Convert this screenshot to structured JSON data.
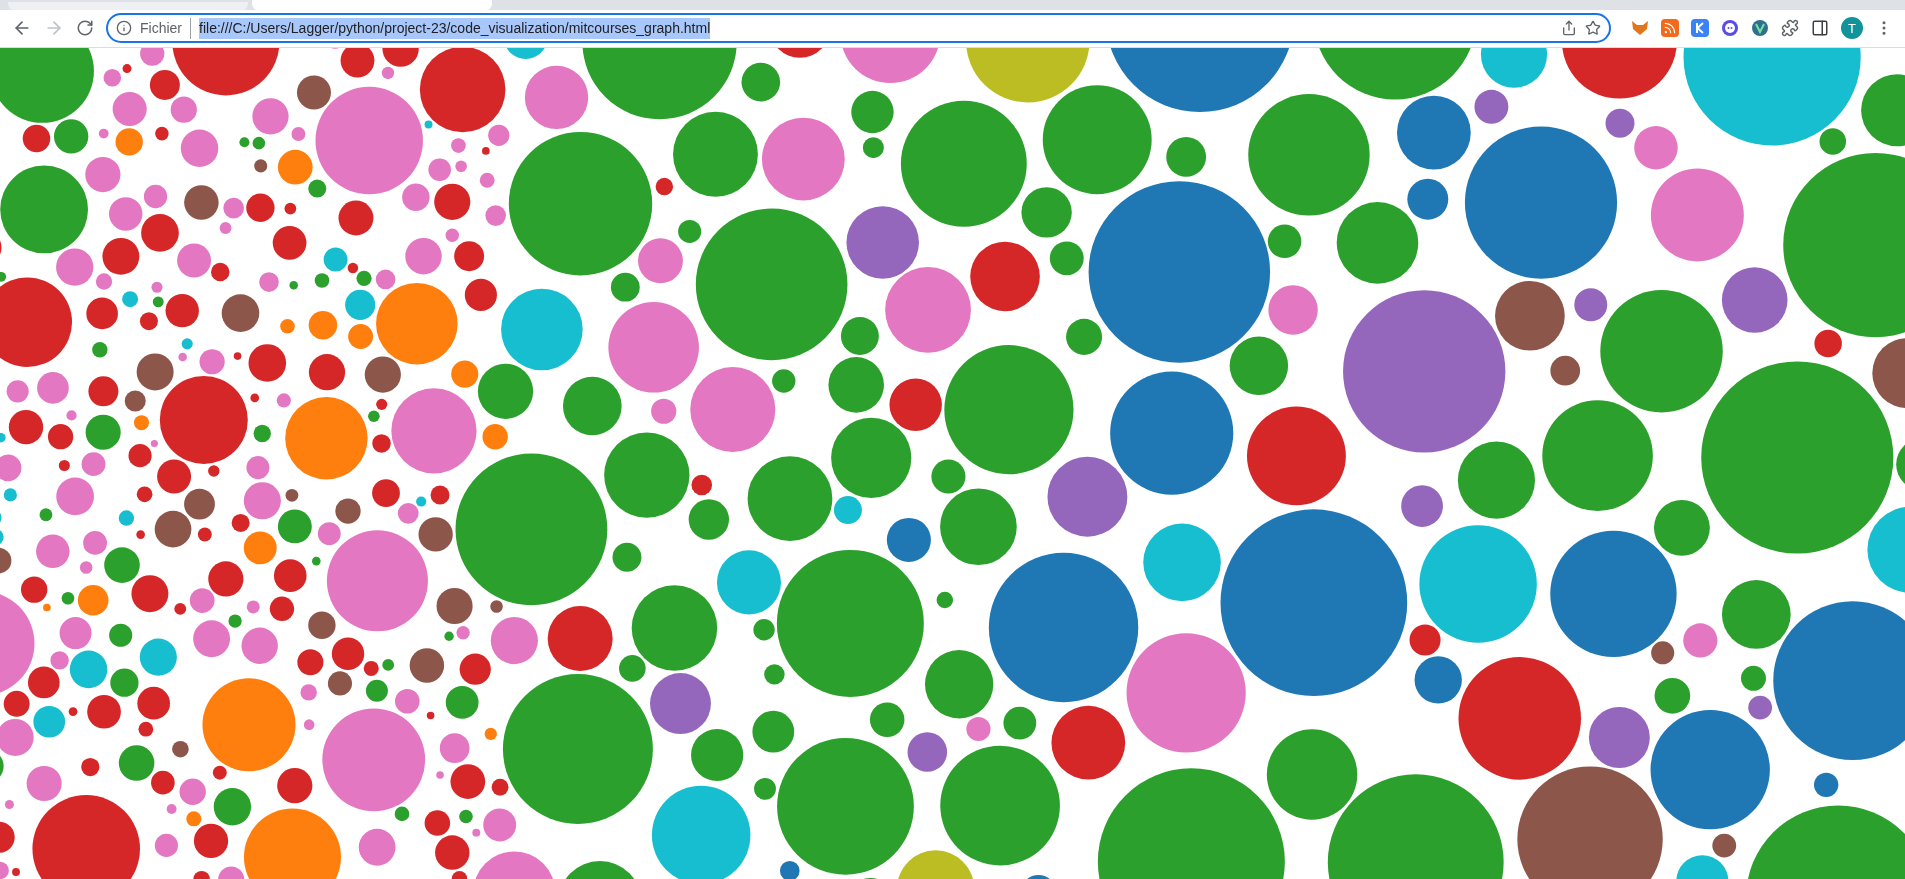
{
  "address_bar": {
    "scheme_label": "Fichier",
    "url": "file:///C:/Users/Lagger/python/project-23/code_visualization/mitcourses_graph.html",
    "url_selected": true
  },
  "profile": {
    "initial": "T"
  }
}
